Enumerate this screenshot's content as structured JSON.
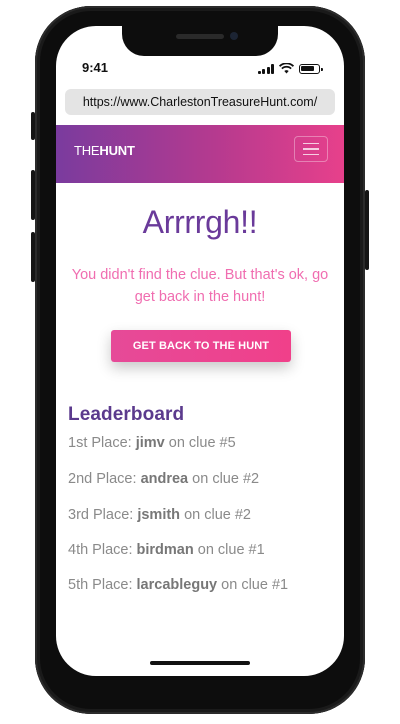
{
  "status_bar": {
    "time": "9:41"
  },
  "browser": {
    "url": "https://www.CharlestonTreasureHunt.com/"
  },
  "navbar": {
    "brand_light": "THE",
    "brand_bold": "HUNT",
    "menu_icon": "hamburger-icon"
  },
  "main": {
    "headline": "Arrrrgh!!",
    "message": "You didn't find the clue. But that's ok, go get back in the hunt!",
    "cta_label": "GET BACK TO THE HUNT"
  },
  "leaderboard": {
    "title": "Leaderboard",
    "entries": [
      {
        "place": "1st Place:",
        "name": "jimv",
        "clue": "on clue #5"
      },
      {
        "place": "2nd Place:",
        "name": "andrea",
        "clue": "on clue #2"
      },
      {
        "place": "3rd Place:",
        "name": "jsmith",
        "clue": "on clue #2"
      },
      {
        "place": "4th Place:",
        "name": "birdman",
        "clue": "on clue #1"
      },
      {
        "place": "5th Place:",
        "name": "larcableguy",
        "clue": "on clue #1"
      }
    ]
  },
  "colors": {
    "nav_gradient_start": "#7a3b9e",
    "nav_gradient_end": "#e7408b",
    "headline": "#6a3a9a",
    "message": "#f06db0",
    "cta": "#e64a98",
    "leaderboard_title": "#5b3a8d"
  }
}
